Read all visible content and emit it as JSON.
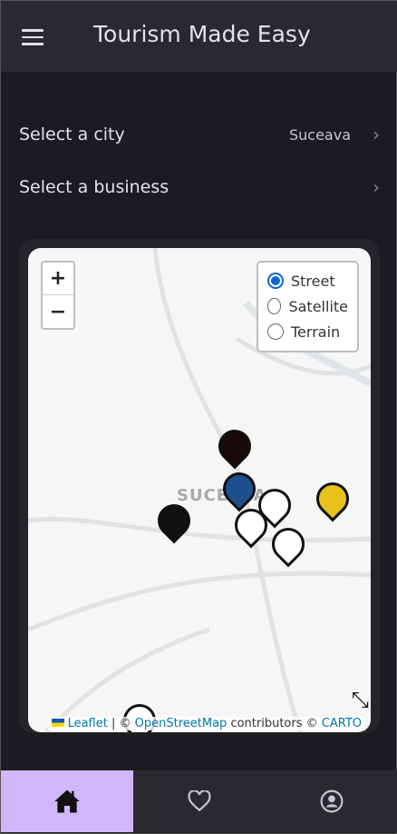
{
  "header": {
    "title": "Tourism Made Easy",
    "menu_icon": "hamburger-icon"
  },
  "selectors": [
    {
      "label": "Select a city",
      "value": "Suceava"
    },
    {
      "label": "Select a business",
      "value": ""
    }
  ],
  "map": {
    "city_label": "SUCEAVA",
    "zoom_in": "+",
    "zoom_out": "−",
    "layers": [
      {
        "label": "Street",
        "selected": true
      },
      {
        "label": "Satellite",
        "selected": false
      },
      {
        "label": "Terrain",
        "selected": false
      }
    ],
    "attribution": {
      "leaflet": "Leaflet",
      "sep": "| ©",
      "osm": "OpenStreetMap",
      "contrib": "contributors ©",
      "carto": "CARTO"
    },
    "marker_count": 8
  },
  "nav": [
    {
      "icon": "home-icon",
      "active": true
    },
    {
      "icon": "heart-icon",
      "active": false
    },
    {
      "icon": "account-icon",
      "active": false
    }
  ],
  "colors": {
    "accent": "#d0b6fa",
    "header": "#2b2930",
    "bg": "#1c1b1f"
  }
}
